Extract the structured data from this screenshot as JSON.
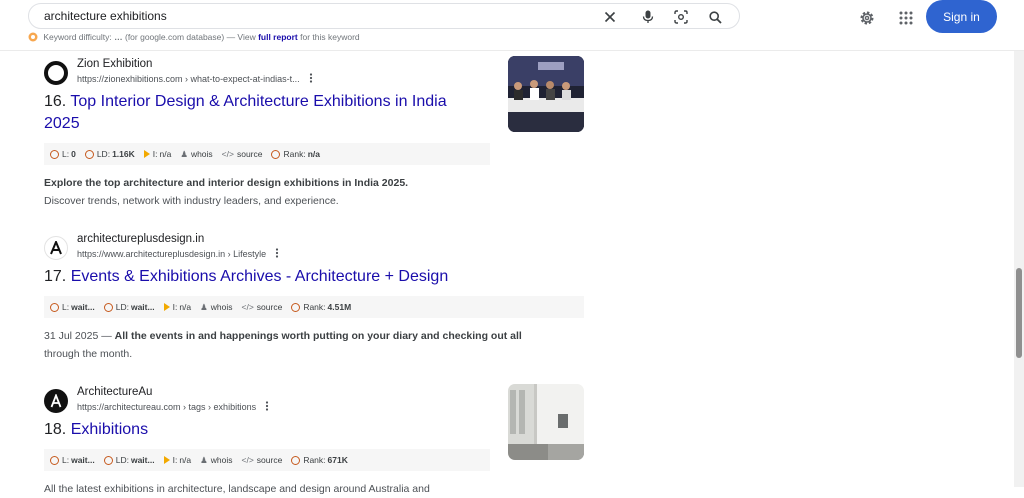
{
  "search": {
    "query": "architecture exhibitions",
    "keyword_label": "Keyword difficulty:",
    "keyword_value": "…",
    "keyword_db": "(for google.com database) — View",
    "keyword_link": "full report",
    "keyword_tail": "for this keyword"
  },
  "header": {
    "signin_label": "Sign in"
  },
  "results": [
    {
      "site_name": "Zion Exhibition",
      "url": "https://zionexhibitions.com › what-to-expect-at-indias-t...",
      "number": "16.",
      "title_line1": "Top Interior Design & Architecture Exhibitions in India",
      "title_line2": "2025",
      "metrics": {
        "l": "0",
        "ld": "1.16K",
        "i": "n/a",
        "whois": "whois",
        "source": "source",
        "rank": "n/a"
      },
      "snippet_bold": "Explore the top architecture and interior design exhibitions in India 2025.",
      "snippet_rest": "Discover trends, network with industry leaders, and experience."
    },
    {
      "site_name": "architectureplusdesign.in",
      "url": "https://www.architectureplusdesign.in › Lifestyle",
      "number": "17.",
      "title": "Events & Exhibitions Archives - Architecture + Design",
      "metrics": {
        "l": "wait...",
        "ld": "wait...",
        "i": "n/a",
        "whois": "whois",
        "source": "source",
        "rank": "4.51M"
      },
      "snippet_date": "31 Jul 2025 —",
      "snippet_bold": "All the events in and happenings worth putting on your diary and checking out all",
      "snippet_rest": "through the month."
    },
    {
      "site_name": "ArchitectureAu",
      "url": "https://architectureau.com › tags › exhibitions",
      "number": "18.",
      "title": "Exhibitions",
      "metrics": {
        "l": "wait...",
        "ld": "wait...",
        "i": "n/a",
        "whois": "whois",
        "source": "source",
        "rank": "671K"
      },
      "snippet": "All the latest exhibitions in architecture, landscape and design around Australia and"
    }
  ],
  "labels": {
    "l": "L:",
    "ld": "LD:",
    "i": "I:",
    "rank": "Rank:"
  },
  "icons": {
    "clear": "close-icon",
    "mic": "microphone-icon",
    "lens": "camera-lens-icon",
    "search": "search-icon",
    "settings": "gear-icon",
    "apps": "apps-grid-icon"
  },
  "colors": {
    "link": "#1a0dab",
    "signin": "#2f64d0",
    "metric_ring": "#c65a1e"
  }
}
